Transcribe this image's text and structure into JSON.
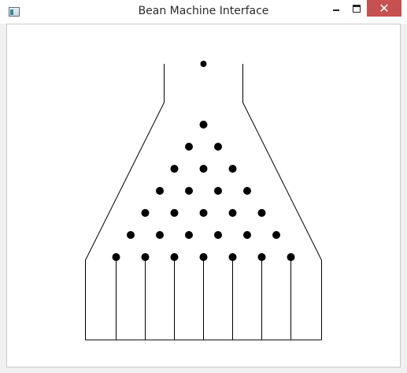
{
  "window": {
    "title": "Bean Machine Interface",
    "close_glyph": "✕",
    "icon": "app-window-icon"
  },
  "machine": {
    "colors": {
      "stroke": "#000000",
      "peg": "#000000",
      "ball": "#000000",
      "background": "#ffffff"
    },
    "peg_rows": [
      1,
      2,
      3,
      4,
      5,
      6,
      7
    ],
    "slot_count": 8,
    "ball_count": 1
  }
}
